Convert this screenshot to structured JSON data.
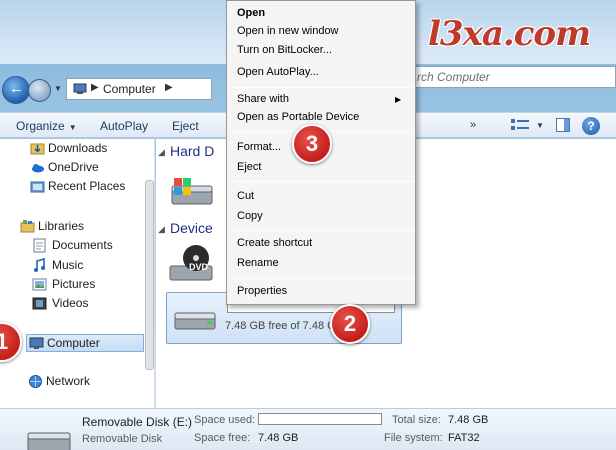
{
  "watermark": "l3xa.com",
  "address": {
    "location": "Computer"
  },
  "search": {
    "placeholder": "rch Computer"
  },
  "toolbar": {
    "organize": "Organize",
    "autoplay": "AutoPlay",
    "eject": "Eject",
    "more": "»"
  },
  "nav": {
    "items": [
      {
        "label": "Downloads",
        "icon": "downloads-folder-icon"
      },
      {
        "label": "OneDrive",
        "icon": "onedrive-cloud-icon"
      },
      {
        "label": "Recent Places",
        "icon": "recent-places-icon"
      },
      {
        "label": "Libraries",
        "icon": "libraries-icon"
      },
      {
        "label": "Documents",
        "icon": "documents-icon"
      },
      {
        "label": "Music",
        "icon": "music-icon"
      },
      {
        "label": "Pictures",
        "icon": "pictures-icon"
      },
      {
        "label": "Videos",
        "icon": "videos-icon"
      },
      {
        "label": "Computer",
        "icon": "computer-icon"
      },
      {
        "label": "Network",
        "icon": "network-icon"
      }
    ],
    "selected": "Computer"
  },
  "content": {
    "hard_disk_header": "Hard D",
    "devices_header": "Device",
    "removable_free": "7.48 GB free of 7.48 GB",
    "dvd_label": "DVD"
  },
  "context_menu": {
    "items": [
      {
        "label": "Open",
        "bold": true
      },
      {
        "label": "Open in new window"
      },
      {
        "label": "Turn on BitLocker..."
      },
      {
        "label": "Open AutoPlay..."
      },
      {
        "label": "Share with",
        "submenu": true
      },
      {
        "label": "Open as Portable Device"
      },
      {
        "label": "Format..."
      },
      {
        "label": "Eject"
      },
      {
        "label": "Cut"
      },
      {
        "label": "Copy"
      },
      {
        "label": "Create shortcut"
      },
      {
        "label": "Rename"
      },
      {
        "label": "Properties"
      }
    ]
  },
  "details": {
    "title": "Removable Disk (E:)",
    "subtitle": "Removable Disk",
    "space_used_label": "Space used:",
    "space_free_label": "Space free:",
    "space_free_value": "7.48 GB",
    "total_size_label": "Total size:",
    "total_size_value": "7.48 GB",
    "file_system_label": "File system:",
    "file_system_value": "FAT32"
  },
  "callouts": [
    "1",
    "2",
    "3"
  ],
  "colors": {
    "accent": "#1e3287",
    "badge": "#c41f1a",
    "watermark": "#c03a2b"
  }
}
